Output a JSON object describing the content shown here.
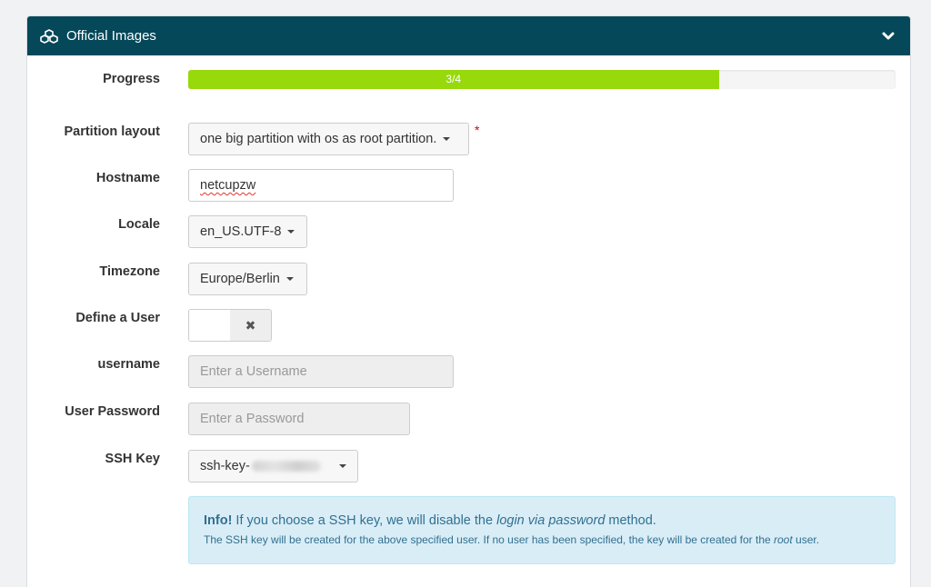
{
  "panel": {
    "title": "Official Images",
    "title_icon": "cubes-icon",
    "collapse_icon": "chevron-down-icon"
  },
  "progress": {
    "label": "Progress",
    "text": "3/4",
    "value": 0.75,
    "color": "#97d90b"
  },
  "partition": {
    "label": "Partition layout",
    "value": "one big partition with os as root partition.",
    "required_mark": "*"
  },
  "hostname": {
    "label": "Hostname",
    "value": "netcupzw"
  },
  "locale": {
    "label": "Locale",
    "value": "en_US.UTF-8"
  },
  "timezone": {
    "label": "Timezone",
    "value": "Europe/Berlin"
  },
  "define_user": {
    "label": "Define a User",
    "state": "off",
    "off_symbol": "✖"
  },
  "username": {
    "label": "username",
    "placeholder": "Enter a Username"
  },
  "password": {
    "label": "User Password",
    "placeholder": "Enter a Password"
  },
  "ssh_key": {
    "label": "SSH Key",
    "value_prefix": "ssh-key-"
  },
  "info": {
    "strong": "Info!",
    "text1": " If you choose a SSH key, we will disable the ",
    "em1": "login via password",
    "text2": " method.",
    "text3": "The SSH key will be created for the above specified user. If no user has been specified, the key will be created for the ",
    "em2": "root",
    "text4": " user."
  },
  "colors": {
    "header_bg": "#054859",
    "info_bg": "#d9edf7",
    "info_text": "#31708f"
  }
}
